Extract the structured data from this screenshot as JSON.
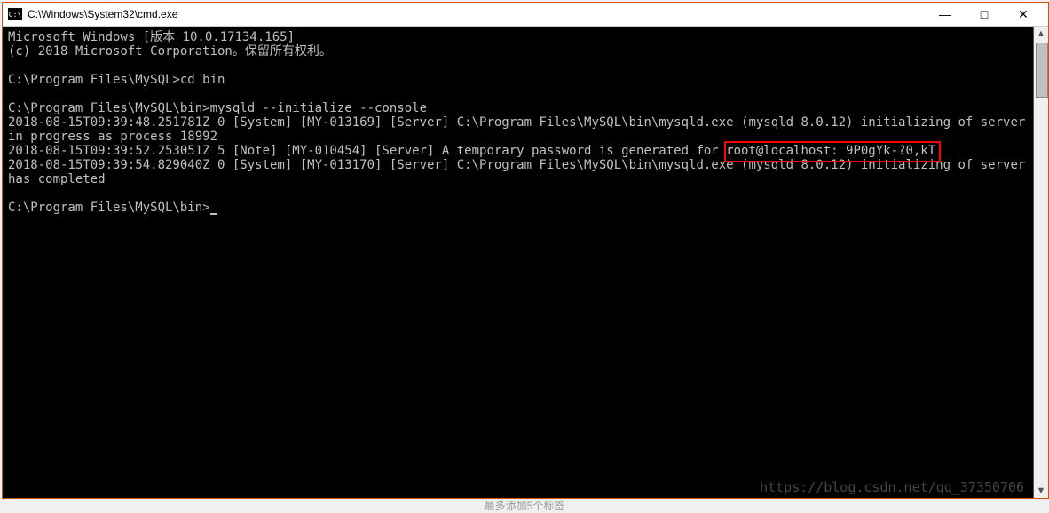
{
  "titlebar": {
    "icon_text": "C:\\",
    "title": "C:\\Windows\\System32\\cmd.exe",
    "minimize": "—",
    "maximize": "□",
    "close": "✕"
  },
  "terminal": {
    "line1": "Microsoft Windows [版本 10.0.17134.165]",
    "line2": "(c) 2018 Microsoft Corporation。保留所有权利。",
    "blank1": "",
    "line3": "C:\\Program Files\\MySQL>cd bin",
    "blank2": "",
    "line4": "C:\\Program Files\\MySQL\\bin>mysqld --initialize --console",
    "line5": "2018-08-15T09:39:48.251781Z 0 [System] [MY-013169] [Server] C:\\Program Files\\MySQL\\bin\\mysqld.exe (mysqld 8.0.12) initializing of server in progress as process 18992",
    "line6a": "2018-08-15T09:39:52.253051Z 5 [Note] [MY-010454] [Server] A temporary password is generated for ",
    "line6b": "root@localhost: 9P0gYk-?0,kT",
    "line7": "2018-08-15T09:39:54.829040Z 0 [System] [MY-013170] [Server] C:\\Program Files\\MySQL\\bin\\mysqld.exe (mysqld 8.0.12) initializing of server has completed",
    "blank3": "",
    "line8": "C:\\Program Files\\MySQL\\bin>"
  },
  "watermark": "https://blog.csdn.net/qq_37350706",
  "footer": "最多添加5个标签"
}
